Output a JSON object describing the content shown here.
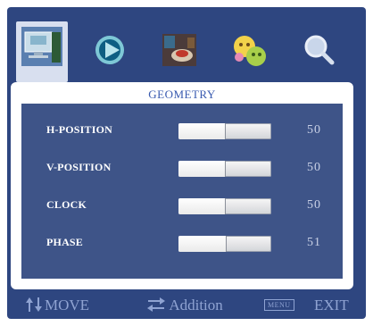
{
  "tabs": [
    {
      "icon": "monitor-geometry-icon",
      "active": true
    },
    {
      "icon": "play-icon",
      "active": false
    },
    {
      "icon": "color-palette-icon",
      "active": false
    },
    {
      "icon": "language-faces-icon",
      "active": false
    },
    {
      "icon": "magnifier-icon",
      "active": false
    }
  ],
  "panel": {
    "title": "GEOMETRY"
  },
  "settings": [
    {
      "label": "H-POSITION",
      "value": "50",
      "level": 0.5
    },
    {
      "label": "V-POSITION",
      "value": "50",
      "level": 0.5
    },
    {
      "label": "CLOCK",
      "value": "50",
      "level": 0.5
    },
    {
      "label": "PHASE",
      "value": "51",
      "level": 0.51
    }
  ],
  "footer": {
    "move_label": "MOVE",
    "addition_label": "Addition",
    "menu_badge": "MENU",
    "exit_label": "EXIT"
  },
  "colors": {
    "osd_bg": "#2e4680",
    "inner_bg": "#3e5488",
    "title": "#3a5bb0",
    "footer_text": "#8fa3d2"
  }
}
